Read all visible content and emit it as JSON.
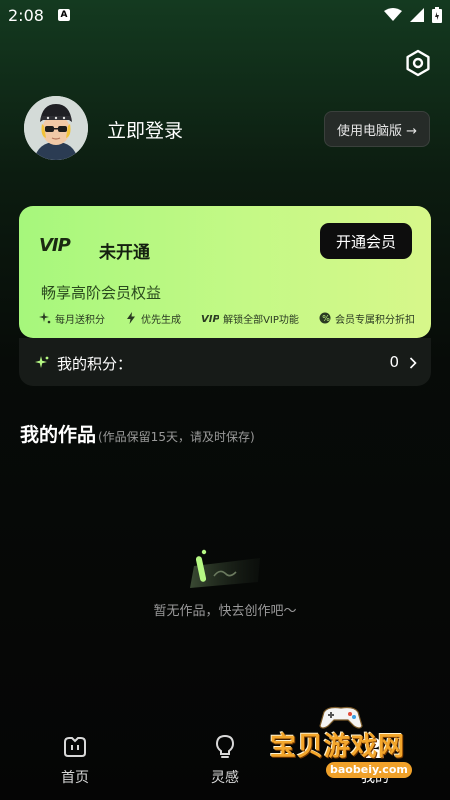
{
  "status_bar": {
    "time": "2:08",
    "notif_icon_letter": "A"
  },
  "header": {
    "login_text": "立即登录",
    "pc_button_label": "使用电脑版 →"
  },
  "vip_card": {
    "logo": "VIP",
    "status": "未开通",
    "subtitle": "畅享高阶会员权益",
    "open_button": "开通会员",
    "benefits": [
      {
        "label": "每月送积分",
        "icon": "sparkle-icon"
      },
      {
        "label": "优先生成",
        "icon": "lightning-icon"
      },
      {
        "label": "解锁全部VIP功能",
        "icon": "vip-icon"
      },
      {
        "label": "会员专属积分折扣",
        "icon": "discount-icon"
      }
    ]
  },
  "points": {
    "label": "我的积分：",
    "value": "0"
  },
  "works": {
    "title": "我的作品",
    "note": "(作品保留15天，请及时保存)"
  },
  "empty_state": {
    "text": "暂无作品，快去创作吧～"
  },
  "tabbar": {
    "tabs": [
      {
        "label": "首页"
      },
      {
        "label": "灵感"
      },
      {
        "label": "我的"
      }
    ]
  },
  "watermark": {
    "text": "宝贝游戏网",
    "url": "baobeiy.com"
  },
  "colors": {
    "accent_green": "#b6f884",
    "background": "#050505",
    "card_dark": "#171b18"
  }
}
